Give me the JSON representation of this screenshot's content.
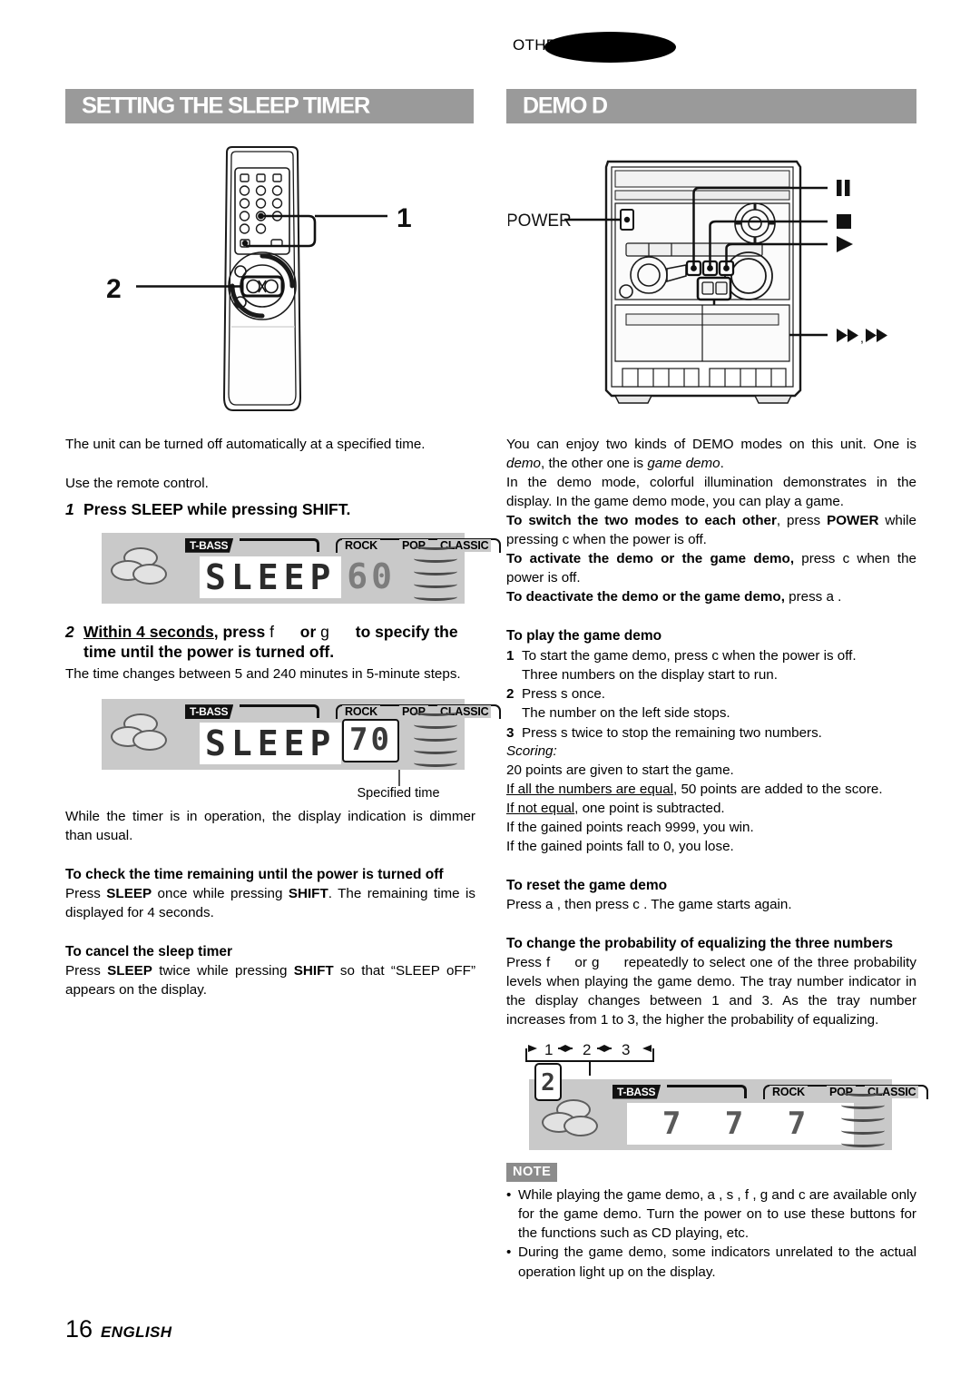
{
  "running_head": "OTHER FUNCTIONS",
  "headers": {
    "left": "SETTING THE SLEEP TIMER",
    "right": "DEMO D"
  },
  "figures": {
    "remote": {
      "callout_1": "1",
      "callout_2": "2"
    },
    "system": {
      "power_label": "POWER",
      "pause_label": "II",
      "stop_label": "■",
      "play_label": "▶",
      "skip_label": "◀◀ , ▶▶"
    }
  },
  "left_column": {
    "intro": "The unit can be turned off automatically at a specified time.",
    "use_remote": "Use the remote control.",
    "step1": {
      "num": "1",
      "text": "Press SLEEP while pressing SHIFT."
    },
    "step2": {
      "num": "2",
      "part_underline": "Within 4 seconds",
      "part_a": ", press ",
      "key_f": "f",
      "part_or": " or ",
      "key_g": "g",
      "part_b": " to specify the time until the power is turned off."
    },
    "step2_note": "The time changes between 5 and 240 minutes in 5-minute steps.",
    "specified_time_caption": "Specified time",
    "dimmer_note": "While the timer is in operation, the display indication is dimmer than usual.",
    "check_heading": "To check the time remaining until the power is turned off",
    "check_body_1": "Press ",
    "check_body_kbd1": "SLEEP",
    "check_body_2": " once while pressing ",
    "check_body_kbd2": "SHIFT",
    "check_body_3": ". The remaining time is displayed for 4 seconds.",
    "cancel_heading": "To cancel the sleep timer",
    "cancel_body_1": "Press ",
    "cancel_body_kbd1": "SLEEP",
    "cancel_body_2": " twice while pressing ",
    "cancel_body_kbd2": "SHIFT",
    "cancel_body_3": " so that “SLEEP oFF” appears on the display."
  },
  "right_column": {
    "intro_1": "You can enjoy two kinds of DEMO modes on this unit. One is ",
    "intro_demo": "demo",
    "intro_2": ", the other one is ",
    "intro_gamedemo": "game demo",
    "intro_3": ".",
    "intro_4": "In the demo mode, colorful illumination demonstrates in the display. In the game demo mode, you can play a game.",
    "switch_bold": "To switch the two modes to each other",
    "switch_rest_1": ", press ",
    "switch_power": "POWER",
    "switch_rest_2": " while pressing c  when the power is off.",
    "activate_bold": "To activate the demo or the game demo,",
    "activate_rest": " press c  when the power is off.",
    "deactivate_bold": "To deactivate the demo or the game demo,",
    "deactivate_rest": " press a .",
    "play_heading": "To play the game demo",
    "play_1a": "To start the game demo, press c  when the power is off.",
    "play_1b": "Three numbers on the display start to run.",
    "play_2a": "Press s  once.",
    "play_2b": "The number on the left side stops.",
    "play_3a": "Press s  twice to stop the remaining two numbers.",
    "scoring_label": "Scoring:",
    "score_1": "20 points are given to start the game.",
    "score_2_u": "If all the numbers are equal",
    "score_2_rest": ", 50 points are added to the score.",
    "score_3_u": "If not equal",
    "score_3_rest": ", one point is subtracted.",
    "score_4": "If the gained points reach 9999, you win.",
    "score_5": "If the gained points fall to 0, you lose.",
    "reset_heading": "To reset the game demo",
    "reset_body": "Press a , then press c  . The game starts again.",
    "prob_heading": "To change the probability of equalizing the three numbers",
    "prob_body_1": "Press ",
    "prob_key_f": "f",
    "prob_body_or": " or ",
    "prob_key_g": "g",
    "prob_body_2": " repeatedly to select one of the three probability levels when playing the game demo. The tray number indicator in the display changes between 1 and 3. As the tray number increases from 1 to 3, the higher the probability of equalizing.",
    "prob_cycle": [
      "1",
      "2",
      "3"
    ],
    "note_badge": "NOTE",
    "note_1": "While playing the game demo, a , s , f   , g    and c   are available only for the game demo. Turn the power on to use these buttons for the functions such as CD playing, etc.",
    "note_2": "During the game demo, some indicators unrelated to the actual operation light up on the display."
  },
  "displays": {
    "sleep_60": {
      "tbass": "T-BASS",
      "eq": [
        "ROCK",
        "POP",
        "CLASSIC"
      ],
      "main_text": "SLEEP",
      "value": "60",
      "boxed": false
    },
    "sleep_70": {
      "tbass": "T-BASS",
      "eq": [
        "ROCK",
        "POP",
        "CLASSIC"
      ],
      "main_text": "SLEEP",
      "value": "70",
      "boxed": true
    },
    "game_777": {
      "tbass": "T-BASS",
      "eq": [
        "ROCK",
        "POP",
        "CLASSIC"
      ],
      "main_text": "7 7 7",
      "tray": "2"
    }
  },
  "footer": {
    "page": "16",
    "language": "ENGLISH"
  },
  "colors": {
    "header_bar": "#9a9a9a",
    "lcd_background": "#c9c9c9",
    "note_badge": "#8c8c8c",
    "text": "#000000"
  }
}
